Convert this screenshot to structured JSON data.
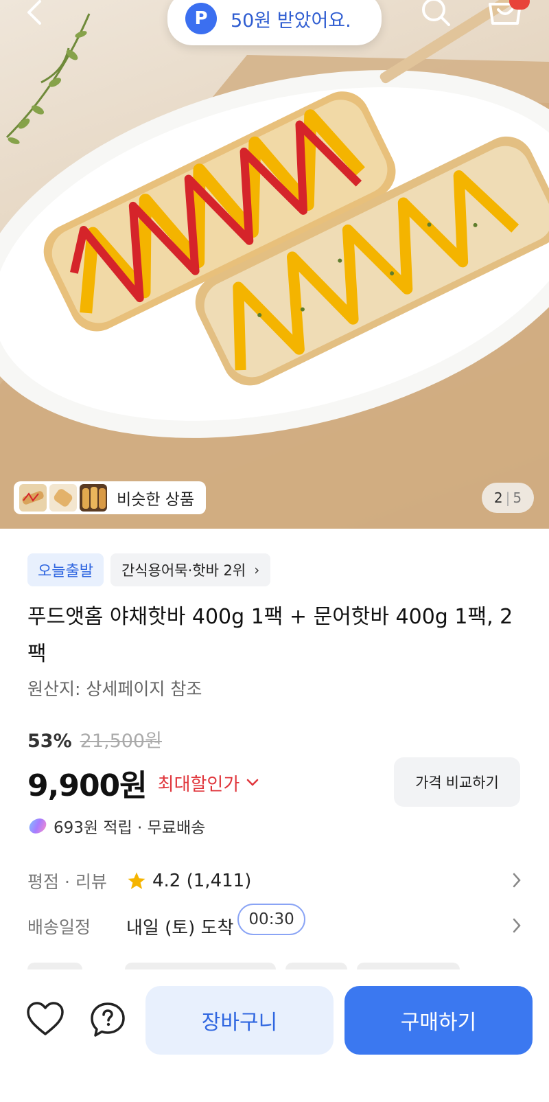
{
  "colors": {
    "accent": "#3b78f0",
    "accent_light": "#e8f0fd",
    "discount_red": "#e0363c",
    "rating_star": "#f5b400"
  },
  "top": {
    "toast_badge": "P",
    "toast_text": "50원 받았어요.",
    "icons": [
      "back-icon",
      "search-icon",
      "cart-icon"
    ]
  },
  "gallery": {
    "similar_label": "비슷한 상품",
    "current_index": "2",
    "separator": "|",
    "total": "5"
  },
  "product": {
    "badge_today": "오늘출발",
    "badge_rank": "간식용어묵·핫바 2위",
    "title": "푸드앳홈 야채핫바 400g 1팩 + 문어핫바 400g 1팩, 2팩",
    "origin": "원산지: 상세페이지 참조",
    "discount_rate": "53%",
    "original_price": "21,500원",
    "price": "9,900원",
    "max_discount_label": "최대할인가",
    "compare_label": "가격 비교하기",
    "reward_text": "693원 적립 · 무료배송"
  },
  "info": {
    "rating_label": "평점 · 리뷰",
    "rating_value": "4.2 (1,411)",
    "delivery_label": "배송일정",
    "delivery_value": "내일 (토) 도착",
    "delivery_timer": "00:30"
  },
  "actions": {
    "cart_label": "장바구니",
    "buy_label": "구매하기"
  }
}
